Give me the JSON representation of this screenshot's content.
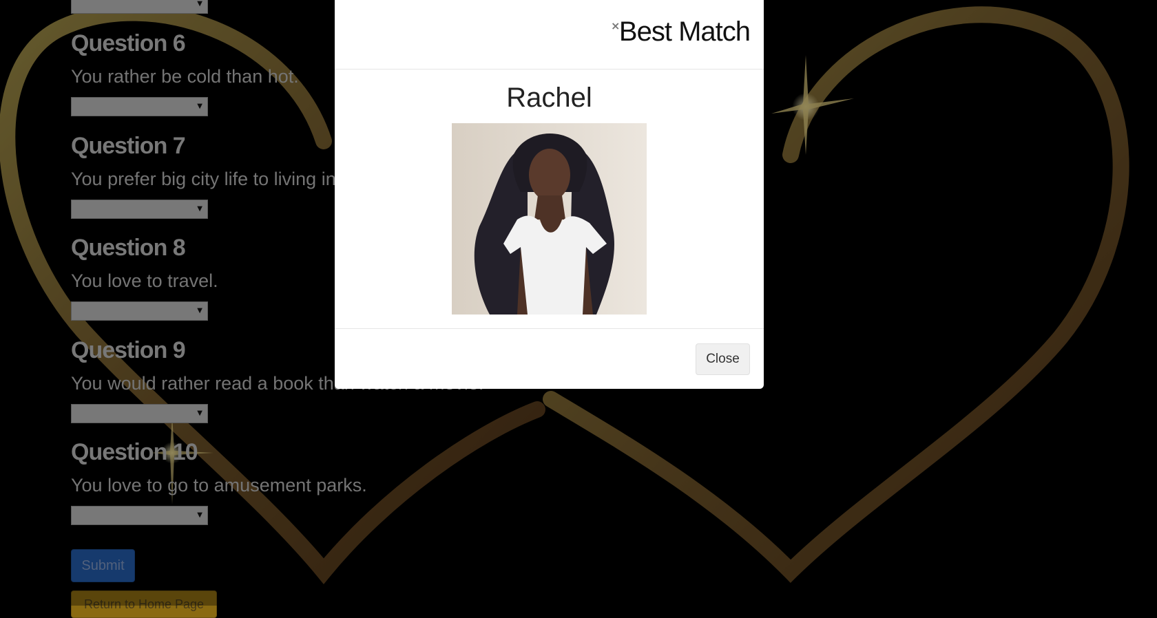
{
  "questions": [
    {
      "title": "Question 6",
      "text": "You rather be cold than hot."
    },
    {
      "title": "Question 7",
      "text": "You prefer big city life to living in a small town."
    },
    {
      "title": "Question 8",
      "text": "You love to travel."
    },
    {
      "title": "Question 9",
      "text": "You would rather read a book than watch a movie."
    },
    {
      "title": "Question 10",
      "text": "You love to go to amusement parks."
    }
  ],
  "form": {
    "submit_label": "Submit",
    "home_label": "Return to Home Page"
  },
  "modal": {
    "close_x": "×",
    "title": "Best Match",
    "match_name": "Rachel",
    "close_label": "Close"
  },
  "icons": [
    "dropdown-arrow-icon",
    "close-icon",
    "sparkle-icon"
  ],
  "colors": {
    "background": "#000000",
    "heart_gold": "#8a7a3c",
    "heart_brown": "#5a3a1c",
    "submit_blue": "#2259a8",
    "home_gold": "#8a6a12",
    "modal_bg": "#ffffff"
  }
}
